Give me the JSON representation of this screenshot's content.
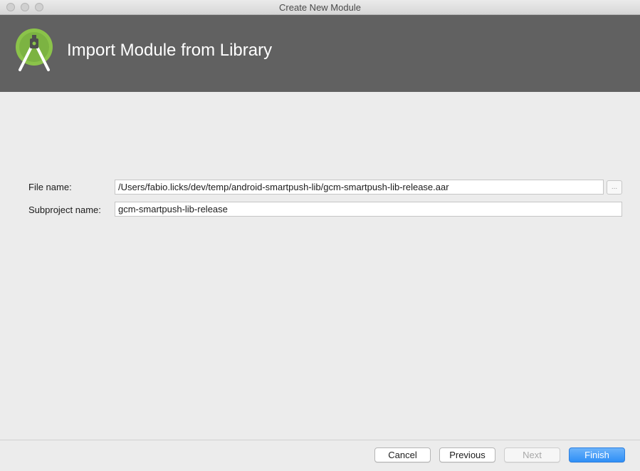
{
  "window": {
    "title": "Create New Module"
  },
  "header": {
    "title": "Import Module from Library"
  },
  "form": {
    "file_name": {
      "label": "File name:",
      "value": "/Users/fabio.licks/dev/temp/android-smartpush-lib/gcm-smartpush-lib-release.aar",
      "browse_label": "..."
    },
    "subproject_name": {
      "label": "Subproject name:",
      "value": "gcm-smartpush-lib-release"
    }
  },
  "footer": {
    "cancel_label": "Cancel",
    "previous_label": "Previous",
    "next_label": "Next",
    "finish_label": "Finish"
  },
  "colors": {
    "banner": "#616161",
    "logo_green": "#8bc34a",
    "accent": "#2f8ff6"
  },
  "icons": {
    "logo": "android-studio-logo-icon",
    "browse": "ellipsis-icon"
  }
}
